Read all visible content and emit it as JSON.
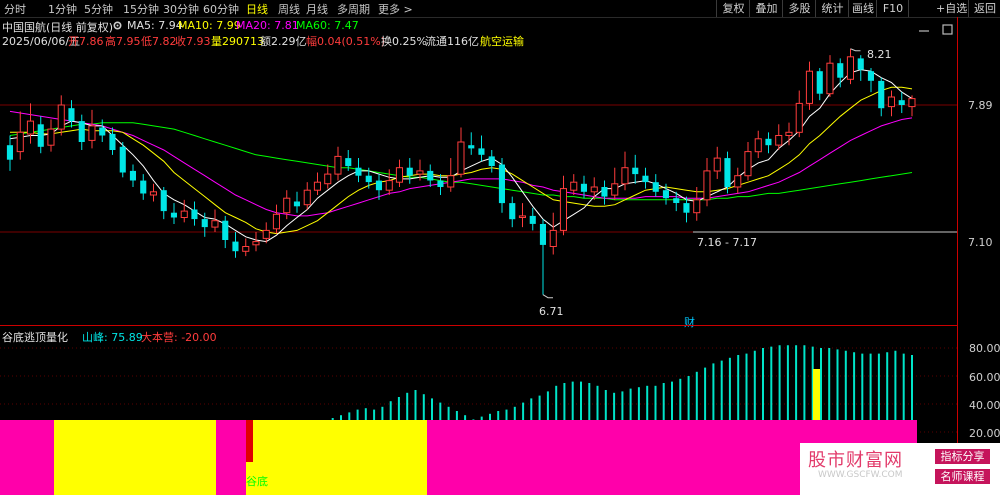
{
  "toolbar": {
    "periods": [
      "分时",
      "1分钟",
      "5分钟",
      "15分钟",
      "30分钟",
      "60分钟",
      "日线",
      "周线",
      "月线",
      "多周期",
      "更多 >"
    ],
    "active_period": "日线",
    "right_buttons": [
      "复权",
      "叠加",
      "多股",
      "统计",
      "画线",
      "F10",
      "+自选",
      "返回"
    ]
  },
  "header": {
    "stock_title": "中国国航(日线 前复权)",
    "ma5": "MA5: 7.94",
    "ma10": "MA10: 7.99",
    "ma20": "MA20: 7.81",
    "ma60": "MA60: 7.47",
    "date": "2025/06/06/五",
    "open": "开7.86",
    "high": "高7.95",
    "low": "低7.82",
    "close": "收7.93",
    "volume": "量290713",
    "amount": "额2.29亿",
    "change": "幅0.04(0.51%)",
    "turnover": "换0.25%",
    "float": "流通116亿",
    "sector": "航空运输"
  },
  "price_axis": {
    "labels": [
      "7.89",
      "7.10"
    ]
  },
  "annotations": {
    "high_label": "8.21",
    "low_label": "6.71",
    "range_label": "7.16 - 7.17",
    "finance_marker": "财"
  },
  "indicator": {
    "name": "谷底逃顶量化",
    "peak": "山峰: 75.89",
    "camp": "大本营: -20.00",
    "axis": [
      "80.00",
      "60.00",
      "40.00",
      "20.00"
    ],
    "bottom_label": "谷底"
  },
  "watermark": {
    "site": "股市财富网",
    "url": "WWW.GSCFW.COM",
    "tag1": "指标分享",
    "tag2": "名师课程"
  },
  "colors": {
    "up": "#ff3c3c",
    "down": "#00e5e5",
    "ma5": "#ffffff",
    "ma10": "#ffff00",
    "ma20": "#ff00ff",
    "ma60": "#00ff00",
    "magenta": "#ff00aa",
    "yellow": "#ffff00",
    "bars": "#00e5c9"
  },
  "chart_data": [
    {
      "type": "candlestick",
      "title": "中国国航(日线 前复权)",
      "candles": [
        [
          7.64,
          7.55,
          7.7,
          7.48
        ],
        [
          7.6,
          7.72,
          7.85,
          7.55
        ],
        [
          7.71,
          7.79,
          7.9,
          7.65
        ],
        [
          7.77,
          7.63,
          7.82,
          7.59
        ],
        [
          7.64,
          7.74,
          7.8,
          7.6
        ],
        [
          7.74,
          7.89,
          7.95,
          7.7
        ],
        [
          7.87,
          7.79,
          7.92,
          7.75
        ],
        [
          7.79,
          7.66,
          7.83,
          7.61
        ],
        [
          7.67,
          7.76,
          7.86,
          7.62
        ],
        [
          7.75,
          7.7,
          7.8,
          7.66
        ],
        [
          7.71,
          7.61,
          7.75,
          7.58
        ],
        [
          7.63,
          7.47,
          7.66,
          7.44
        ],
        [
          7.48,
          7.42,
          7.52,
          7.38
        ],
        [
          7.42,
          7.34,
          7.46,
          7.3
        ],
        [
          7.33,
          7.35,
          7.4,
          7.29
        ],
        [
          7.36,
          7.23,
          7.38,
          7.18
        ],
        [
          7.22,
          7.19,
          7.28,
          7.15
        ],
        [
          7.19,
          7.23,
          7.3,
          7.16
        ],
        [
          7.24,
          7.18,
          7.29,
          7.14
        ],
        [
          7.18,
          7.13,
          7.22,
          7.07
        ],
        [
          7.13,
          7.17,
          7.24,
          7.1
        ],
        [
          7.17,
          7.05,
          7.2,
          7.0
        ],
        [
          7.04,
          6.98,
          7.1,
          6.94
        ],
        [
          6.98,
          7.01,
          7.06,
          6.95
        ],
        [
          7.02,
          7.04,
          7.1,
          6.98
        ],
        [
          7.06,
          7.11,
          7.16,
          7.03
        ],
        [
          7.12,
          7.21,
          7.27,
          7.09
        ],
        [
          7.22,
          7.31,
          7.36,
          7.18
        ],
        [
          7.29,
          7.26,
          7.35,
          7.22
        ],
        [
          7.27,
          7.36,
          7.41,
          7.24
        ],
        [
          7.36,
          7.41,
          7.47,
          7.33
        ],
        [
          7.4,
          7.46,
          7.52,
          7.37
        ],
        [
          7.46,
          7.57,
          7.63,
          7.42
        ],
        [
          7.56,
          7.51,
          7.61,
          7.48
        ],
        [
          7.5,
          7.45,
          7.56,
          7.41
        ],
        [
          7.45,
          7.41,
          7.5,
          7.37
        ],
        [
          7.42,
          7.36,
          7.46,
          7.3
        ],
        [
          7.36,
          7.42,
          7.49,
          7.33
        ],
        [
          7.41,
          7.5,
          7.55,
          7.38
        ],
        [
          7.5,
          7.45,
          7.56,
          7.4
        ],
        [
          7.46,
          7.48,
          7.55,
          7.42
        ],
        [
          7.48,
          7.42,
          7.52,
          7.38
        ],
        [
          7.42,
          7.38,
          7.46,
          7.33
        ],
        [
          7.38,
          7.45,
          7.56,
          7.35
        ],
        [
          7.46,
          7.66,
          7.75,
          7.44
        ],
        [
          7.64,
          7.62,
          7.72,
          7.58
        ],
        [
          7.62,
          7.58,
          7.7,
          7.54
        ],
        [
          7.57,
          7.51,
          7.61,
          7.47
        ],
        [
          7.52,
          7.28,
          7.56,
          7.22
        ],
        [
          7.28,
          7.18,
          7.32,
          7.13
        ],
        [
          7.19,
          7.2,
          7.28,
          7.13
        ],
        [
          7.2,
          7.15,
          7.25,
          7.11
        ],
        [
          7.15,
          7.02,
          7.18,
          6.71
        ],
        [
          7.01,
          7.11,
          7.22,
          6.96
        ],
        [
          7.11,
          7.37,
          7.45,
          7.08
        ],
        [
          7.36,
          7.41,
          7.46,
          7.33
        ],
        [
          7.4,
          7.35,
          7.45,
          7.31
        ],
        [
          7.35,
          7.38,
          7.44,
          7.3
        ],
        [
          7.38,
          7.32,
          7.42,
          7.27
        ],
        [
          7.33,
          7.4,
          7.5,
          7.3
        ],
        [
          7.4,
          7.5,
          7.6,
          7.36
        ],
        [
          7.5,
          7.46,
          7.58,
          7.4
        ],
        [
          7.45,
          7.41,
          7.5,
          7.37
        ],
        [
          7.41,
          7.35,
          7.46,
          7.32
        ],
        [
          7.36,
          7.31,
          7.4,
          7.27
        ],
        [
          7.31,
          7.28,
          7.35,
          7.23
        ],
        [
          7.28,
          7.22,
          7.32,
          7.16
        ],
        [
          7.22,
          7.3,
          7.38,
          7.17
        ],
        [
          7.3,
          7.48,
          7.56,
          7.26
        ],
        [
          7.48,
          7.56,
          7.63,
          7.43
        ],
        [
          7.56,
          7.38,
          7.6,
          7.34
        ],
        [
          7.38,
          7.45,
          7.5,
          7.34
        ],
        [
          7.45,
          7.6,
          7.66,
          7.42
        ],
        [
          7.6,
          7.68,
          7.73,
          7.56
        ],
        [
          7.68,
          7.64,
          7.72,
          7.59
        ],
        [
          7.64,
          7.7,
          7.77,
          7.61
        ],
        [
          7.7,
          7.72,
          7.78,
          7.64
        ],
        [
          7.72,
          7.9,
          7.98,
          7.69
        ],
        [
          7.9,
          8.1,
          8.16,
          7.86
        ],
        [
          8.1,
          7.96,
          8.12,
          7.92
        ],
        [
          7.96,
          8.15,
          8.2,
          7.94
        ],
        [
          8.15,
          8.06,
          8.18,
          8.0
        ],
        [
          8.05,
          8.19,
          8.24,
          8.02
        ],
        [
          8.18,
          8.11,
          8.2,
          8.04
        ],
        [
          8.1,
          8.04,
          8.12,
          7.97
        ],
        [
          8.04,
          7.87,
          8.06,
          7.82
        ],
        [
          7.88,
          7.94,
          7.98,
          7.82
        ],
        [
          7.92,
          7.89,
          7.97,
          7.84
        ],
        [
          7.88,
          7.93,
          7.95,
          7.82
        ]
      ],
      "ma5": [
        7.68,
        7.69,
        7.7,
        7.7,
        7.71,
        7.76,
        7.79,
        7.78,
        7.76,
        7.76,
        7.7,
        7.64,
        7.58,
        7.51,
        7.42,
        7.34,
        7.3,
        7.27,
        7.23,
        7.19,
        7.18,
        7.15,
        7.11,
        7.07,
        7.05,
        7.04,
        7.08,
        7.14,
        7.19,
        7.24,
        7.31,
        7.36,
        7.41,
        7.45,
        7.48,
        7.48,
        7.46,
        7.44,
        7.43,
        7.43,
        7.44,
        7.45,
        7.44,
        7.44,
        7.48,
        7.51,
        7.54,
        7.56,
        7.52,
        7.44,
        7.35,
        7.26,
        7.18,
        7.13,
        7.17,
        7.21,
        7.25,
        7.32,
        7.37,
        7.37,
        7.4,
        7.41,
        7.42,
        7.4,
        7.37,
        7.34,
        7.3,
        7.29,
        7.32,
        7.35,
        7.38,
        7.44,
        7.49,
        7.53,
        7.55,
        7.62,
        7.67,
        7.73,
        7.82,
        7.87,
        7.96,
        8.03,
        8.09,
        8.11,
        8.1,
        8.06,
        8.03,
        7.97,
        7.93
      ],
      "ma10": [
        7.72,
        7.72,
        7.72,
        7.71,
        7.71,
        7.72,
        7.73,
        7.74,
        7.73,
        7.73,
        7.73,
        7.72,
        7.68,
        7.64,
        7.59,
        7.54,
        7.47,
        7.42,
        7.37,
        7.32,
        7.27,
        7.22,
        7.19,
        7.16,
        7.12,
        7.1,
        7.09,
        7.1,
        7.11,
        7.14,
        7.17,
        7.22,
        7.27,
        7.32,
        7.36,
        7.39,
        7.41,
        7.42,
        7.44,
        7.45,
        7.46,
        7.46,
        7.45,
        7.45,
        7.46,
        7.47,
        7.49,
        7.5,
        7.49,
        7.46,
        7.42,
        7.38,
        7.34,
        7.3,
        7.29,
        7.28,
        7.27,
        7.26,
        7.26,
        7.27,
        7.3,
        7.33,
        7.36,
        7.37,
        7.38,
        7.37,
        7.36,
        7.35,
        7.35,
        7.36,
        7.37,
        7.39,
        7.41,
        7.43,
        7.45,
        7.49,
        7.53,
        7.58,
        7.65,
        7.7,
        7.76,
        7.82,
        7.87,
        7.92,
        7.95,
        7.98,
        8.0,
        8.0,
        7.99
      ],
      "ma20": [
        7.85,
        7.84,
        7.83,
        7.82,
        7.81,
        7.8,
        7.79,
        7.78,
        7.77,
        7.76,
        7.74,
        7.72,
        7.7,
        7.67,
        7.64,
        7.61,
        7.57,
        7.53,
        7.49,
        7.45,
        7.41,
        7.37,
        7.33,
        7.3,
        7.27,
        7.24,
        7.22,
        7.21,
        7.2,
        7.2,
        7.21,
        7.22,
        7.24,
        7.26,
        7.28,
        7.3,
        7.32,
        7.34,
        7.35,
        7.37,
        7.38,
        7.39,
        7.4,
        7.41,
        7.42,
        7.43,
        7.43,
        7.43,
        7.43,
        7.42,
        7.41,
        7.39,
        7.38,
        7.36,
        7.35,
        7.34,
        7.33,
        7.32,
        7.31,
        7.31,
        7.31,
        7.31,
        7.32,
        7.32,
        7.32,
        7.32,
        7.31,
        7.31,
        7.31,
        7.32,
        7.33,
        7.34,
        7.35,
        7.37,
        7.39,
        7.41,
        7.44,
        7.47,
        7.51,
        7.55,
        7.59,
        7.63,
        7.67,
        7.7,
        7.73,
        7.76,
        7.78,
        7.8,
        7.81
      ],
      "ma60": [
        7.7,
        7.71,
        7.72,
        7.73,
        7.74,
        7.75,
        7.76,
        7.77,
        7.77,
        7.78,
        7.78,
        7.78,
        7.78,
        7.77,
        7.76,
        7.75,
        7.74,
        7.72,
        7.7,
        7.68,
        7.66,
        7.64,
        7.62,
        7.6,
        7.58,
        7.57,
        7.56,
        7.55,
        7.54,
        7.53,
        7.52,
        7.51,
        7.5,
        7.5,
        7.49,
        7.48,
        7.47,
        7.46,
        7.45,
        7.44,
        7.44,
        7.43,
        7.42,
        7.41,
        7.41,
        7.4,
        7.39,
        7.38,
        7.37,
        7.36,
        7.35,
        7.34,
        7.33,
        7.33,
        7.32,
        7.32,
        7.31,
        7.31,
        7.31,
        7.3,
        7.3,
        7.3,
        7.3,
        7.3,
        7.3,
        7.3,
        7.3,
        7.3,
        7.3,
        7.31,
        7.31,
        7.32,
        7.32,
        7.33,
        7.34,
        7.34,
        7.35,
        7.36,
        7.37,
        7.38,
        7.39,
        7.4,
        7.41,
        7.42,
        7.43,
        7.44,
        7.45,
        7.46,
        7.47
      ]
    },
    {
      "type": "bar",
      "title": "谷底逃顶量化",
      "ylim": [
        10,
        86
      ],
      "values": [
        0,
        0,
        0,
        0,
        0,
        0,
        0,
        0,
        0,
        0,
        0,
        0,
        0,
        0,
        0,
        0,
        0,
        0,
        0,
        0,
        0,
        0,
        0,
        0,
        0,
        0,
        0,
        0,
        0,
        0,
        0,
        0,
        0,
        0,
        0,
        0,
        0,
        0,
        0,
        30,
        32,
        34,
        36,
        37,
        36,
        38,
        42,
        45,
        48,
        50,
        47,
        44,
        41,
        38,
        35,
        32,
        29,
        31,
        33,
        35,
        36,
        38,
        41,
        44,
        46,
        49,
        53,
        55,
        56,
        56,
        55,
        53,
        50,
        48,
        49,
        51,
        52,
        53,
        53,
        55,
        56,
        58,
        60,
        63,
        66,
        69,
        71,
        73,
        75,
        76,
        78,
        80,
        81,
        82,
        82,
        82,
        82,
        81,
        80,
        80,
        79,
        78,
        77,
        76,
        76,
        76,
        77,
        78,
        76,
        75
      ],
      "camp_segments": [
        [
          "magenta",
          0,
          54
        ],
        [
          "yellow",
          54,
          216
        ],
        [
          "magenta",
          216,
          246
        ],
        [
          "yellow",
          246,
          427
        ],
        [
          "magenta",
          427,
          917
        ]
      ]
    }
  ]
}
